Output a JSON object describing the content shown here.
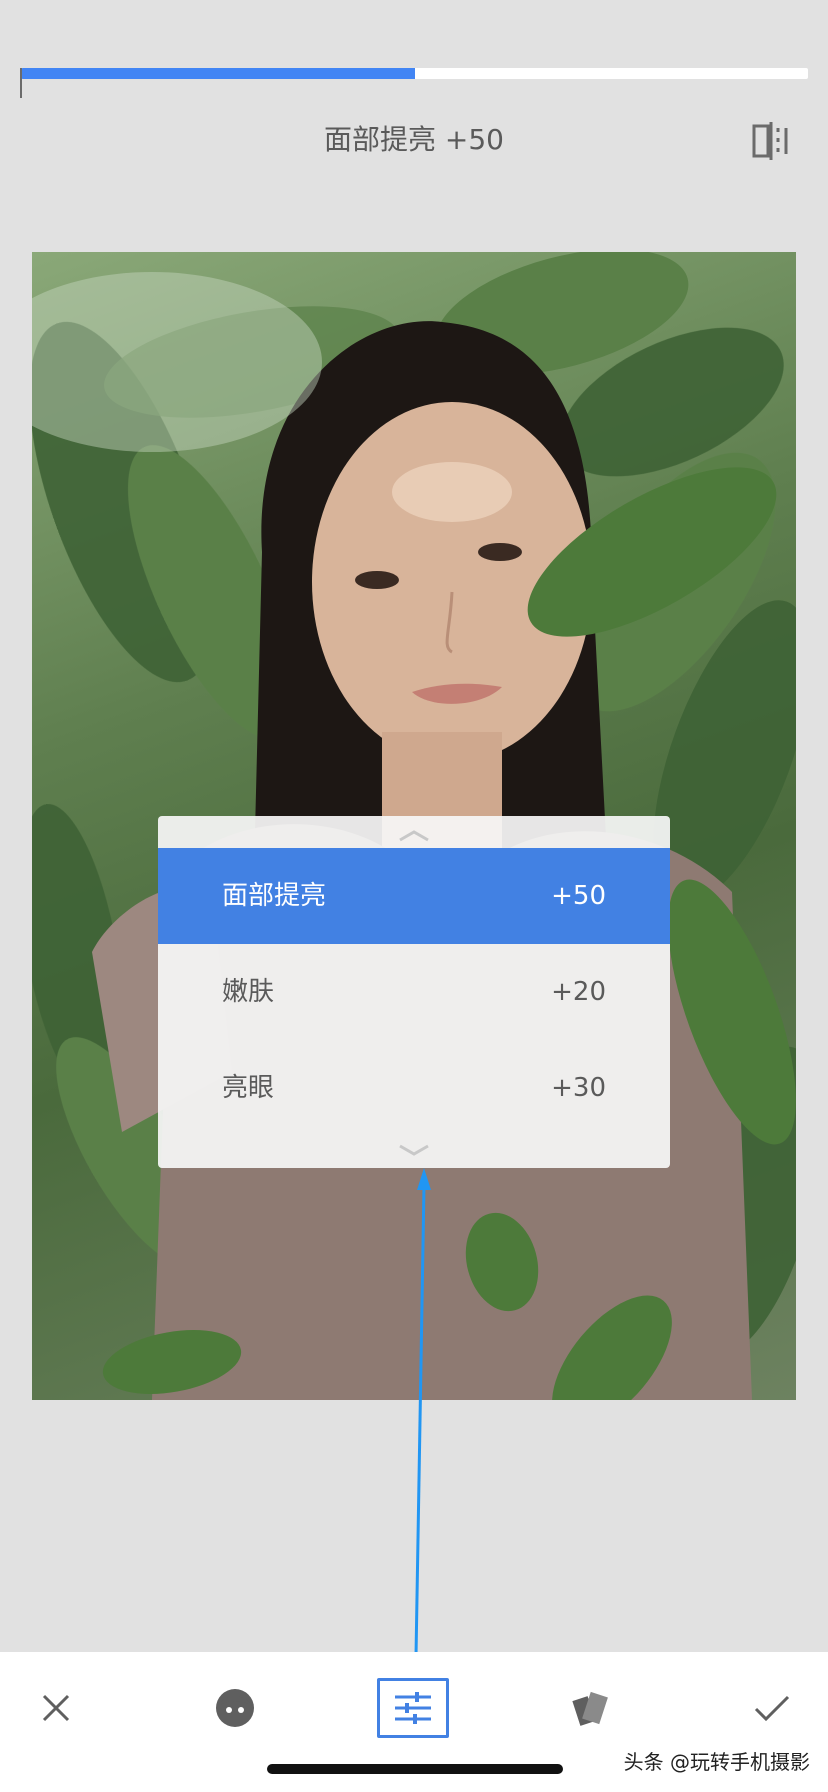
{
  "header": {
    "title": "面部提亮 +50",
    "progress_fraction": 0.5
  },
  "menu": {
    "items": [
      {
        "label": "面部提亮",
        "value": "+50",
        "active": true
      },
      {
        "label": "嫩肤",
        "value": "+20",
        "active": false
      },
      {
        "label": "亮眼",
        "value": "+30",
        "active": false
      }
    ]
  },
  "toolbar": {
    "tools": [
      "close-icon",
      "face-icon",
      "adjust-sliders-icon",
      "styles-icon",
      "checkmark-icon"
    ],
    "selected": "adjust-sliders-icon"
  },
  "colors": {
    "accent": "#4281e3",
    "annotation_arrow": "#2196f3",
    "background": "#e1e1e1"
  },
  "watermark": "头条 @玩转手机摄影"
}
